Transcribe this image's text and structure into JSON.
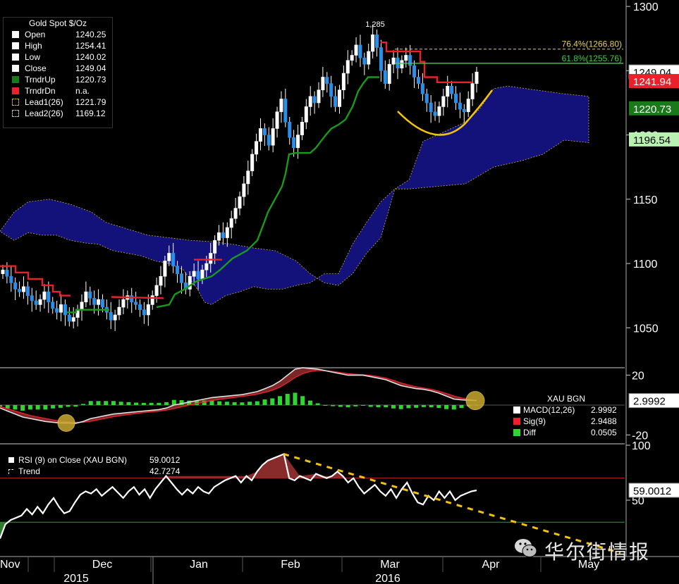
{
  "chart_data": [
    {
      "type": "candlestick",
      "title": "Gold Spot $/Oz",
      "ylim": [
        1020,
        1305
      ],
      "yticks": [
        1050,
        1100,
        1150,
        1200,
        1250,
        1300
      ],
      "ytick_labels": [
        "1050",
        "1100",
        "1150",
        "1200",
        "1250",
        "1300"
      ],
      "legend": [
        {
          "name": "Open",
          "value": "1240.25"
        },
        {
          "name": "High",
          "value": "1254.41"
        },
        {
          "name": "Low",
          "value": "1240.02"
        },
        {
          "name": "Close",
          "value": "1249.04"
        },
        {
          "name": "TrndrUp",
          "value": "1220.73"
        },
        {
          "name": "TrndrDn",
          "value": "n.a."
        },
        {
          "name": "Lead1(26)",
          "value": "1221.79"
        },
        {
          "name": "Lead2(26)",
          "value": "1169.12"
        }
      ],
      "axis_badges": [
        {
          "label": "1249.04",
          "value": 1249.04,
          "color": "#ffffff"
        },
        {
          "label": "1241.94",
          "value": 1241.94,
          "color": "#e8212a"
        },
        {
          "label": "1220.73",
          "value": 1220.73,
          "color": "#1a7a1a"
        },
        {
          "label": "1196.54",
          "value": 1196.54,
          "color": "#b9f2b0"
        }
      ],
      "annotations": {
        "peak_label": "1,285",
        "fib_764": {
          "label": "76.4%(1266.80)",
          "value": 1266.8
        },
        "fib_618": {
          "label": "61.8%(1255.76)",
          "value": 1255.76
        }
      },
      "close": [
        1095,
        1090,
        1085,
        1080,
        1078,
        1082,
        1075,
        1071,
        1068,
        1072,
        1078,
        1070,
        1065,
        1062,
        1068,
        1060,
        1055,
        1058,
        1064,
        1070,
        1078,
        1073,
        1068,
        1072,
        1066,
        1062,
        1056,
        1060,
        1066,
        1072,
        1075,
        1070,
        1068,
        1064,
        1060,
        1068,
        1075,
        1083,
        1090,
        1102,
        1108,
        1098,
        1092,
        1085,
        1080,
        1090,
        1094,
        1088,
        1095,
        1100,
        1108,
        1118,
        1124,
        1120,
        1128,
        1135,
        1143,
        1152,
        1162,
        1172,
        1185,
        1195,
        1205,
        1200,
        1192,
        1205,
        1218,
        1228,
        1210,
        1198,
        1190,
        1200,
        1210,
        1222,
        1230,
        1225,
        1235,
        1245,
        1240,
        1230,
        1222,
        1235,
        1248,
        1258,
        1262,
        1270,
        1260,
        1255,
        1265,
        1278,
        1268,
        1250,
        1240,
        1255,
        1260,
        1252,
        1258,
        1262,
        1254,
        1245,
        1240,
        1232,
        1225,
        1218,
        1215,
        1222,
        1230,
        1238,
        1232,
        1225,
        1220,
        1218,
        1228,
        1240,
        1249
      ]
    },
    {
      "type": "line",
      "title": "XAU BGN",
      "ylim": [
        -25,
        25
      ],
      "yticks": [
        -20,
        20
      ],
      "ytick_labels": [
        "-20",
        "20"
      ],
      "legend": [
        {
          "name": "MACD(12,26)",
          "value": "2.9992"
        },
        {
          "name": "Sig(9)",
          "value": "2.9488"
        },
        {
          "name": "Diff",
          "value": "0.0505"
        }
      ],
      "axis_badge": "2.9992",
      "macd": [
        -2,
        -4,
        -6,
        -8,
        -9,
        -10,
        -11,
        -11.5,
        -12,
        -12,
        -12.2,
        -11,
        -9,
        -8,
        -7,
        -6,
        -5.5,
        -5,
        -4.5,
        -4,
        -3.5,
        -3,
        -2,
        0,
        1,
        2,
        3,
        4,
        5,
        5.5,
        6,
        6.5,
        7,
        8,
        9,
        11,
        13,
        16,
        20,
        24,
        25,
        24.5,
        24,
        23,
        22,
        21,
        20,
        20,
        20,
        19,
        18,
        17,
        15,
        13,
        12,
        11,
        10.5,
        9.5,
        8,
        6,
        4,
        3.5,
        3.2,
        3
      ],
      "signal": [
        -1,
        -2.5,
        -4,
        -5.5,
        -7,
        -8,
        -9,
        -10,
        -10.8,
        -11.2,
        -11.5,
        -11.5,
        -10.8,
        -9.8,
        -8.8,
        -7.8,
        -7,
        -6.3,
        -5.6,
        -5,
        -4.5,
        -4,
        -3.3,
        -2.3,
        -1.2,
        0,
        1,
        2,
        3,
        3.8,
        4.5,
        5.2,
        5.8,
        6.5,
        7.3,
        8.5,
        10,
        12,
        15,
        18.5,
        21,
        22.5,
        23.2,
        23,
        22.5,
        21.8,
        21,
        20.6,
        20.3,
        19.8,
        19,
        18,
        16.5,
        14.8,
        13.4,
        12.2,
        11.4,
        10.5,
        9.3,
        7.8,
        6,
        4.8,
        3.8,
        2.9
      ]
    },
    {
      "type": "line",
      "title": "RSI (9) on Close (XAU BGN)",
      "ylim": [
        0,
        100
      ],
      "yticks": [
        50,
        100
      ],
      "ytick_labels": [
        "50",
        "100"
      ],
      "legend": [
        {
          "name": "RSI (9) on Close (XAU BGN)",
          "value": "59.0012"
        },
        {
          "name": "Trend",
          "value": "42.7274"
        }
      ],
      "axis_badge": "59.0012",
      "rsi": [
        15,
        28,
        32,
        34,
        36,
        42,
        37,
        44,
        38,
        46,
        52,
        44,
        38,
        40,
        48,
        55,
        58,
        56,
        60,
        54,
        58,
        62,
        57,
        52,
        58,
        62,
        55,
        60,
        52,
        60,
        66,
        72,
        66,
        60,
        55,
        60,
        56,
        62,
        58,
        56,
        62,
        65,
        68,
        70,
        72,
        66,
        72,
        68,
        76,
        82,
        86,
        88,
        90,
        92,
        70,
        68,
        72,
        70,
        68,
        74,
        72,
        70,
        72,
        76,
        72,
        66,
        70,
        62,
        56,
        60,
        64,
        58,
        54,
        60,
        52,
        60,
        66,
        56,
        48,
        46,
        54,
        50,
        58,
        52,
        58,
        50,
        54,
        56,
        58,
        59
      ],
      "overbought": 70,
      "oversold": 30
    }
  ],
  "x_axis": {
    "months": [
      "Nov",
      "Dec",
      "Jan",
      "Feb",
      "Mar",
      "Apr",
      "May"
    ],
    "years": [
      "2015",
      "2016"
    ]
  },
  "watermark": "华尔街情报"
}
